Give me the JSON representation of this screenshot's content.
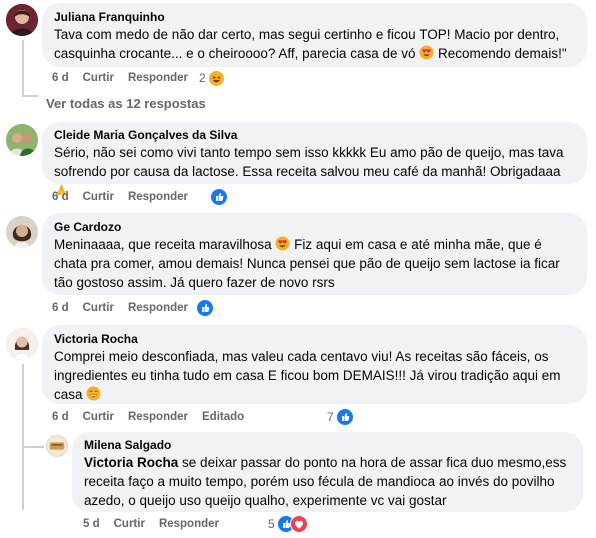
{
  "comments": [
    {
      "author": "Juliana Franquinho",
      "text_a": "Tava com medo de não dar certo, mas segui certinho e ficou TOP! Macio por dentro, casquinha crocante... e o cheiroooo? Aff, parecia casa de vó ",
      "text_b": " Recomendo demais!\"",
      "time": "6 d",
      "like": "Curtir",
      "reply": "Responder",
      "reaction_count": "2",
      "reaction_icon": "haha-icon"
    },
    {
      "author": "Cleide Maria Gonçalves da Silva",
      "text": "Sério, não sei como vivi tanto tempo sem isso kkkkk Eu amo pão de queijo, mas tava sofrendo por causa da lactose. Essa receita salvou meu café da manhã! Obrigadaaa ",
      "time": "6 d",
      "like": "Curtir",
      "reply": "Responder",
      "reaction_icon": "like-icon"
    },
    {
      "author": "Ge Cardozo",
      "text_a": "Meninaaaa, que receita maravilhosa ",
      "text_b": " Fiz aqui em casa e até minha mãe, que é chata pra comer, amou demais! Nunca pensei que pão de queijo sem lactose ia ficar tão gostoso assim. Já quero fazer de novo rsrs",
      "time": "6 d",
      "like": "Curtir",
      "reply": "Responder",
      "reaction_icon": "like-icon"
    },
    {
      "author": "Victoria Rocha",
      "text": "Comprei meio desconfiada, mas valeu cada centavo viu! As receitas são fáceis, os ingredientes eu tinha tudo em casa E ficou bom DEMAIS!!! Já virou tradição aqui em casa ",
      "time": "6 d",
      "like": "Curtir",
      "reply": "Responder",
      "edited": "Editado",
      "reaction_count": "7",
      "reaction_icon": "like-icon"
    }
  ],
  "see_replies": "Ver todas as 12 respostas",
  "reply": {
    "author": "Milena Salgado",
    "mention": "Victoria Rocha",
    "text": " se deixar passar do ponto na hora de assar fica duo mesmo,ess receita faço a muito tempo, porém uso fécula de mandioca ao invés do povilho azedo, o queijo uso queijo qualho, experimente vc vai gostar",
    "time": "5 d",
    "like": "Curtir",
    "reply": "Responder",
    "reaction_count": "5",
    "reaction_icons": [
      "like-icon",
      "love-icon"
    ]
  },
  "colors": {
    "bubble": "#f0f2f5",
    "meta": "#65676b",
    "like": "#1877f2",
    "love": "#f33e58",
    "haha": "#f7b125"
  }
}
